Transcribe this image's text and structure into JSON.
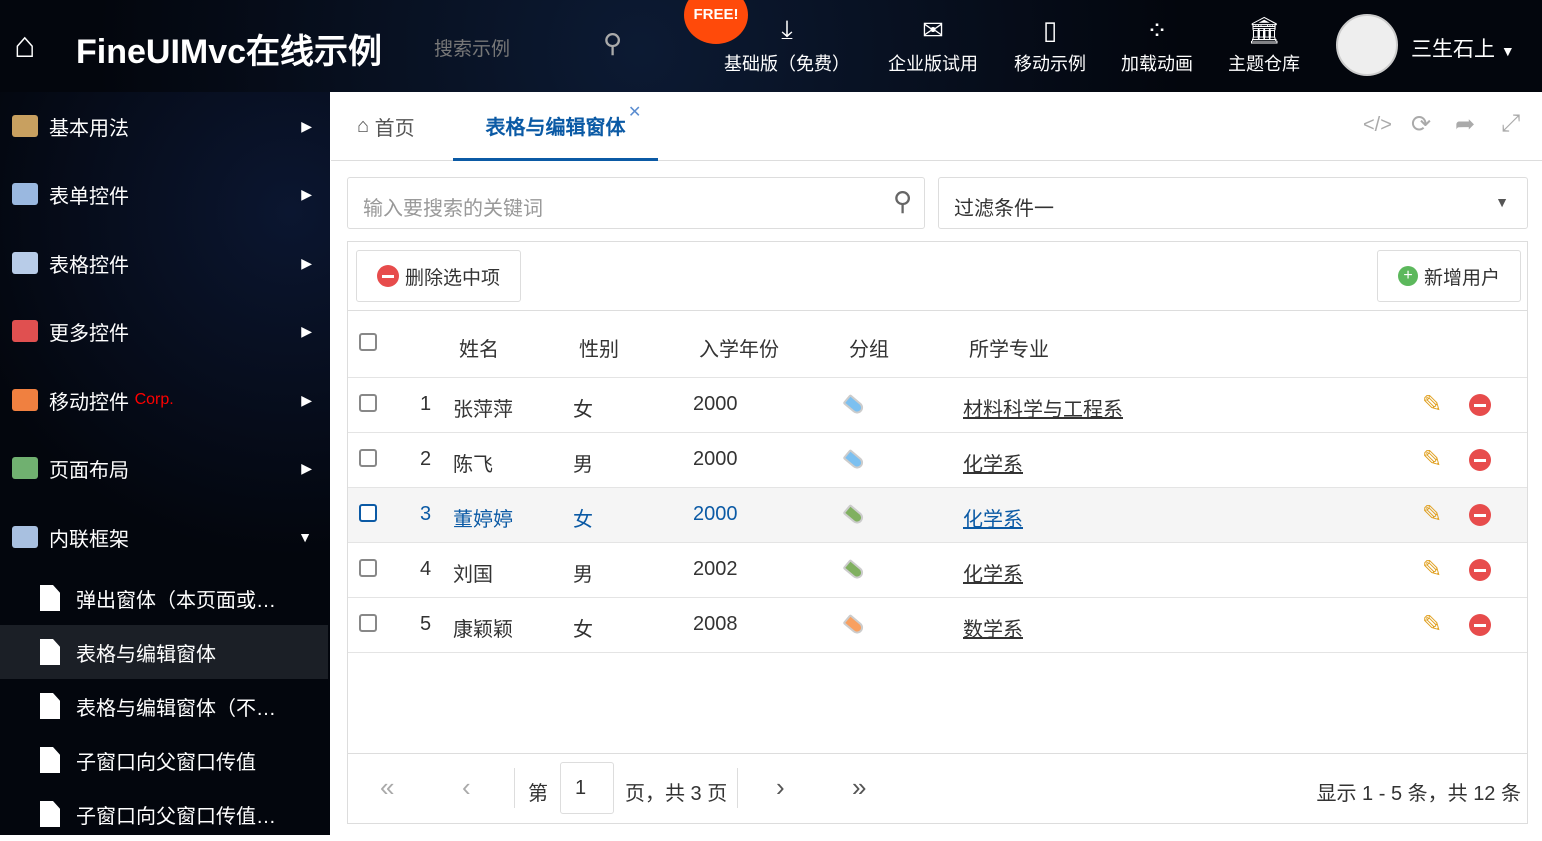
{
  "header": {
    "title": "FineUIMvc在线示例",
    "search_placeholder": "搜索示例",
    "free_badge": "FREE!",
    "nav": [
      {
        "label": "基础版（免费）",
        "icon": "download-icon"
      },
      {
        "label": "企业版试用",
        "icon": "envelope-icon"
      },
      {
        "label": "移动示例",
        "icon": "mobile-icon"
      },
      {
        "label": "加载动画",
        "icon": "spinner-icon"
      },
      {
        "label": "主题仓库",
        "icon": "bank-icon"
      }
    ],
    "user": "三生石上"
  },
  "sidebar": {
    "items": [
      {
        "label": "基本用法",
        "color": "#c8a060"
      },
      {
        "label": "表单控件",
        "color": "#9ab8e0"
      },
      {
        "label": "表格控件",
        "color": "#b8cce8"
      },
      {
        "label": "更多控件",
        "color": "#e05050"
      },
      {
        "label": "移动控件",
        "badge": "Corp.",
        "color": "#f08040"
      },
      {
        "label": "页面布局",
        "color": "#70b070"
      },
      {
        "label": "内联框架",
        "color": "#a8c0e0"
      }
    ],
    "subitems": [
      "弹出窗体（本页面或…",
      "表格与编辑窗体",
      "表格与编辑窗体（不…",
      "子窗口向父窗口传值",
      "子窗口向父窗口传值…"
    ]
  },
  "tabs": {
    "home": "首页",
    "active": "表格与编辑窗体"
  },
  "search": {
    "placeholder": "输入要搜索的关键词",
    "filter": "过滤条件一"
  },
  "toolbar": {
    "delete": "删除选中项",
    "add": "新增用户"
  },
  "grid": {
    "columns": [
      "姓名",
      "性别",
      "入学年份",
      "分组",
      "所学专业"
    ],
    "rows": [
      {
        "idx": "1",
        "name": "张萍萍",
        "gender": "女",
        "year": "2000",
        "tag": "#7cc0f0",
        "major": "材料科学与工程系"
      },
      {
        "idx": "2",
        "name": "陈飞",
        "gender": "男",
        "year": "2000",
        "tag": "#7cc0f0",
        "major": "化学系"
      },
      {
        "idx": "3",
        "name": "董婷婷",
        "gender": "女",
        "year": "2000",
        "tag": "#80b060",
        "major": "化学系"
      },
      {
        "idx": "4",
        "name": "刘国",
        "gender": "男",
        "year": "2002",
        "tag": "#80b060",
        "major": "化学系"
      },
      {
        "idx": "5",
        "name": "康颖颖",
        "gender": "女",
        "year": "2008",
        "tag": "#f8a060",
        "major": "数学系"
      }
    ]
  },
  "pager": {
    "page_prefix": "第",
    "page": "1",
    "page_suffix": "页，共 3 页",
    "summary": "显示 1 - 5 条，共 12 条"
  }
}
